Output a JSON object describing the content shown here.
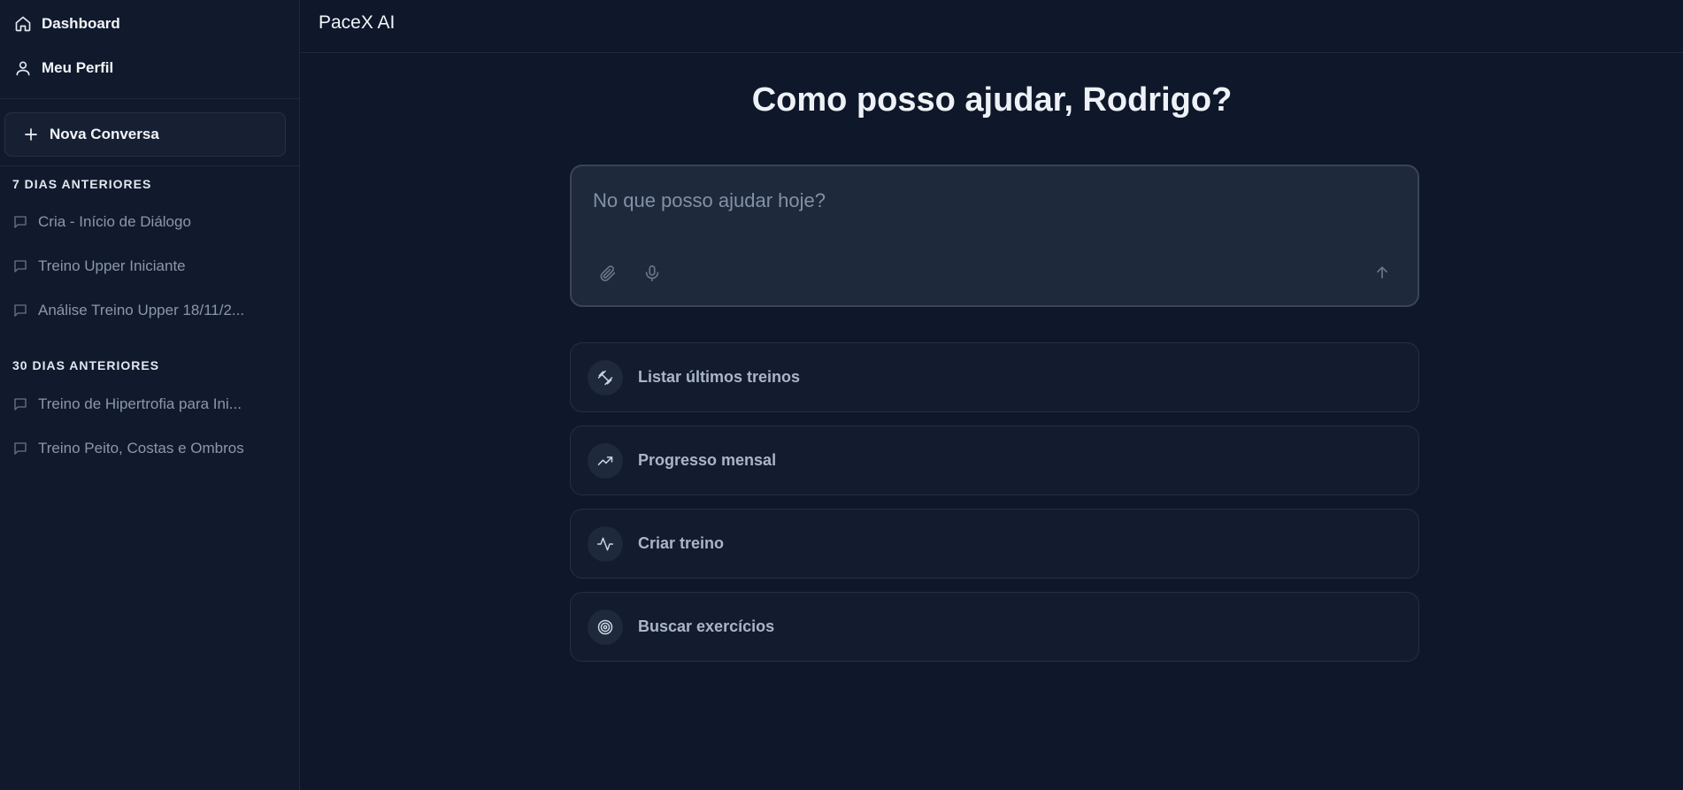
{
  "sidebar": {
    "nav": [
      {
        "label": "Dashboard",
        "icon": "home-icon"
      },
      {
        "label": "Meu Perfil",
        "icon": "user-icon"
      }
    ],
    "new_chat_label": "Nova Conversa",
    "sections": [
      {
        "title": "7 DIAS ANTERIORES",
        "items": [
          {
            "label": "Cria - Início de Diálogo"
          },
          {
            "label": "Treino Upper Iniciante"
          },
          {
            "label": "Análise Treino Upper 18/11/2..."
          }
        ]
      },
      {
        "title": "30 DIAS ANTERIORES",
        "items": [
          {
            "label": "Treino de Hipertrofia para Ini..."
          },
          {
            "label": "Treino Peito, Costas e Ombros"
          }
        ]
      }
    ]
  },
  "header": {
    "title": "PaceX AI"
  },
  "main": {
    "greeting": "Como posso ajudar, Rodrigo?",
    "composer": {
      "placeholder": "No que posso ajudar hoje?",
      "attach_icon": "paperclip-icon",
      "mic_icon": "microphone-icon",
      "send_icon": "arrow-up-icon"
    },
    "suggestions": [
      {
        "label": "Listar últimos treinos",
        "icon": "dumbbell-icon"
      },
      {
        "label": "Progresso mensal",
        "icon": "trending-up-icon"
      },
      {
        "label": "Criar treino",
        "icon": "activity-icon"
      },
      {
        "label": "Buscar exercícios",
        "icon": "target-icon"
      }
    ]
  },
  "colors": {
    "background": "#0f172a",
    "sidebar": "#111a2c",
    "card": "#131c2e",
    "composer": "#1e293b"
  }
}
